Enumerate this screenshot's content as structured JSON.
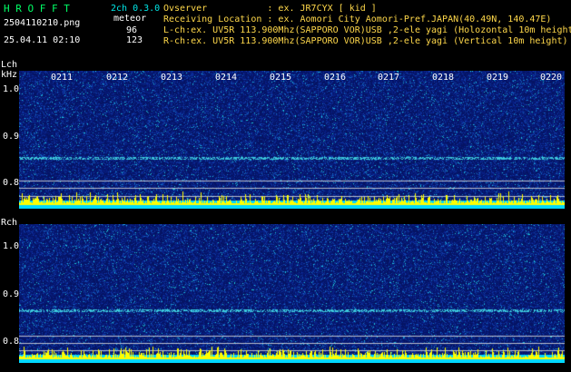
{
  "header": {
    "app_name": "H R O F F T",
    "version": "2ch 0.3.0",
    "filename": "2504110210.png",
    "type_label": "meteor",
    "datetime": "25.04.11 02:10",
    "lch_count": "96",
    "rch_count": "123",
    "observer": "Ovserver           : ex. JR7CYX [ kid ]",
    "location": "Receiving Location : ex. Aomori City Aomori-Pref.JAPAN(40.49N, 140.47E)",
    "lch_info": "L-ch:ex. UV5R 113.900Mhz(SAPPORO VOR)USB ,2-ele yagi (Holozontal 10m height)",
    "rch_info": "R-ch:ex. UV5R 113.900Mhz(SAPPORO VOR)USB ,2-ele yagi (Vertical 10m height)"
  },
  "time_ticks": [
    "0211",
    "0212",
    "0213",
    "0214",
    "0215",
    "0216",
    "0217",
    "0218",
    "0219",
    "0220"
  ],
  "lch": {
    "label": "Lch",
    "unit": "kHz",
    "y_ticks": [
      "1.0",
      "0.9",
      "0.8"
    ]
  },
  "rch": {
    "label": "Rch",
    "y_ticks": [
      "1.0",
      "0.9",
      "0.8"
    ]
  },
  "colors": {
    "header_green": "#00ff66",
    "header_cyan": "#00e6e6",
    "header_yellow": "#ffd84a",
    "signal_yellow": "#ffff00",
    "noise_floor": "#00e5ff",
    "waterfall_bg": "#0a1a6e"
  }
}
